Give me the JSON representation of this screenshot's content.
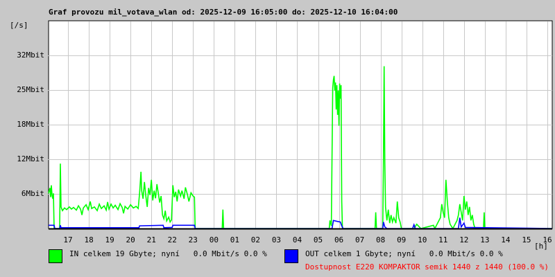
{
  "chart_data": {
    "type": "line",
    "title": "Graf provozu mil_votava_wlan od: 2025-12-09 16:05:00 do: 2025-12-10 16:04:00",
    "ylabel": "[/s]",
    "xlabel": "[h]",
    "x_units": "minutes since 16:05",
    "xlim": [
      0,
      1450
    ],
    "ylim": [
      0,
      38.4
    ],
    "grid": true,
    "y_ticks": [
      {
        "value": 6.4,
        "label": "6Mbit"
      },
      {
        "value": 12.8,
        "label": "12Mbit"
      },
      {
        "value": 19.2,
        "label": "18Mbit"
      },
      {
        "value": 25.6,
        "label": "25Mbit"
      },
      {
        "value": 32.0,
        "label": "32Mbit"
      }
    ],
    "x_ticks": [
      {
        "value": 56,
        "label": "17"
      },
      {
        "value": 116,
        "label": "18"
      },
      {
        "value": 176,
        "label": "19"
      },
      {
        "value": 236,
        "label": "20"
      },
      {
        "value": 296,
        "label": "21"
      },
      {
        "value": 356,
        "label": "22"
      },
      {
        "value": 416,
        "label": "23"
      },
      {
        "value": 476,
        "label": "00"
      },
      {
        "value": 536,
        "label": "01"
      },
      {
        "value": 596,
        "label": "02"
      },
      {
        "value": 656,
        "label": "03"
      },
      {
        "value": 716,
        "label": "04"
      },
      {
        "value": 776,
        "label": "05"
      },
      {
        "value": 836,
        "label": "06"
      },
      {
        "value": 896,
        "label": "07"
      },
      {
        "value": 956,
        "label": "08"
      },
      {
        "value": 1016,
        "label": "09"
      },
      {
        "value": 1076,
        "label": "10"
      },
      {
        "value": 1136,
        "label": "11"
      },
      {
        "value": 1196,
        "label": "12"
      },
      {
        "value": 1256,
        "label": "13"
      },
      {
        "value": 1316,
        "label": "14"
      },
      {
        "value": 1376,
        "label": "15"
      },
      {
        "value": 1436,
        "label": "16"
      }
    ],
    "series": [
      {
        "name": "IN",
        "color": "#00ff00",
        "points": [
          [
            0,
            6.5
          ],
          [
            4,
            7.5
          ],
          [
            6,
            5.8
          ],
          [
            8,
            8.0
          ],
          [
            10,
            6.2
          ],
          [
            12,
            5.5
          ],
          [
            14,
            6.5
          ],
          [
            16,
            0
          ],
          [
            32,
            0
          ],
          [
            34,
            12
          ],
          [
            36,
            4
          ],
          [
            40,
            3.3
          ],
          [
            46,
            3.8
          ],
          [
            52,
            3.5
          ],
          [
            60,
            4.0
          ],
          [
            66,
            3.6
          ],
          [
            72,
            3.9
          ],
          [
            80,
            3.4
          ],
          [
            86,
            4.2
          ],
          [
            92,
            3.6
          ],
          [
            96,
            2.5
          ],
          [
            100,
            3.8
          ],
          [
            108,
            4.4
          ],
          [
            114,
            3.5
          ],
          [
            120,
            5.0
          ],
          [
            124,
            3.7
          ],
          [
            132,
            4.0
          ],
          [
            140,
            3.3
          ],
          [
            146,
            4.5
          ],
          [
            152,
            3.7
          ],
          [
            160,
            4.2
          ],
          [
            166,
            3.4
          ],
          [
            170,
            4.9
          ],
          [
            174,
            3.6
          ],
          [
            180,
            4.5
          ],
          [
            186,
            3.8
          ],
          [
            192,
            4.3
          ],
          [
            200,
            3.5
          ],
          [
            206,
            4.6
          ],
          [
            212,
            3.9
          ],
          [
            216,
            2.8
          ],
          [
            220,
            4.1
          ],
          [
            228,
            3.6
          ],
          [
            236,
            4.4
          ],
          [
            244,
            3.8
          ],
          [
            252,
            4.1
          ],
          [
            258,
            3.7
          ],
          [
            262,
            6.5
          ],
          [
            266,
            10.5
          ],
          [
            268,
            7.0
          ],
          [
            272,
            5.5
          ],
          [
            276,
            8.6
          ],
          [
            280,
            6.0
          ],
          [
            284,
            4.0
          ],
          [
            288,
            7.5
          ],
          [
            292,
            6.2
          ],
          [
            296,
            9.0
          ],
          [
            300,
            5.2
          ],
          [
            304,
            7.0
          ],
          [
            308,
            5.6
          ],
          [
            312,
            8.2
          ],
          [
            316,
            6.5
          ],
          [
            320,
            4.8
          ],
          [
            324,
            6.0
          ],
          [
            328,
            2.5
          ],
          [
            332,
            1.8
          ],
          [
            336,
            3.3
          ],
          [
            340,
            1.4
          ],
          [
            346,
            2.1
          ],
          [
            350,
            1.2
          ],
          [
            354,
            1.6
          ],
          [
            358,
            8.0
          ],
          [
            362,
            5.8
          ],
          [
            366,
            6.8
          ],
          [
            370,
            5.0
          ],
          [
            374,
            7.2
          ],
          [
            380,
            6.0
          ],
          [
            384,
            7.0
          ],
          [
            390,
            5.5
          ],
          [
            394,
            7.6
          ],
          [
            400,
            6.2
          ],
          [
            404,
            5.0
          ],
          [
            410,
            6.6
          ],
          [
            416,
            6.0
          ],
          [
            420,
            5.8
          ],
          [
            422,
            0
          ],
          [
            500,
            0
          ],
          [
            502,
            3.5
          ],
          [
            504,
            0
          ],
          [
            808,
            0
          ],
          [
            810,
            1.5
          ],
          [
            814,
            0.5
          ],
          [
            818,
            26
          ],
          [
            820,
            27.5
          ],
          [
            822,
            28.2
          ],
          [
            824,
            25.5
          ],
          [
            826,
            27
          ],
          [
            828,
            22
          ],
          [
            830,
            26.5
          ],
          [
            832,
            21
          ],
          [
            834,
            25.5
          ],
          [
            836,
            19
          ],
          [
            838,
            26.8
          ],
          [
            840,
            24
          ],
          [
            842,
            26.5
          ],
          [
            844,
            5
          ],
          [
            846,
            0
          ],
          [
            940,
            0
          ],
          [
            942,
            3
          ],
          [
            944,
            0
          ],
          [
            962,
            0
          ],
          [
            964,
            12.5
          ],
          [
            966,
            30
          ],
          [
            968,
            12
          ],
          [
            970,
            4
          ],
          [
            974,
            1.5
          ],
          [
            978,
            3.5
          ],
          [
            982,
            1.0
          ],
          [
            986,
            2.5
          ],
          [
            990,
            1.2
          ],
          [
            994,
            2.0
          ],
          [
            1000,
            1.0
          ],
          [
            1004,
            5.0
          ],
          [
            1008,
            2.0
          ],
          [
            1012,
            1.2
          ],
          [
            1016,
            0
          ],
          [
            1052,
            0
          ],
          [
            1060,
            0.8
          ],
          [
            1072,
            0
          ],
          [
            1108,
            0.6
          ],
          [
            1112,
            0
          ],
          [
            1128,
            2.0
          ],
          [
            1132,
            4.5
          ],
          [
            1136,
            3.0
          ],
          [
            1140,
            2.0
          ],
          [
            1144,
            9.0
          ],
          [
            1148,
            5.0
          ],
          [
            1152,
            2.0
          ],
          [
            1156,
            0.8
          ],
          [
            1164,
            0
          ],
          [
            1176,
            1.5
          ],
          [
            1180,
            2.5
          ],
          [
            1184,
            4.5
          ],
          [
            1188,
            3.0
          ],
          [
            1192,
            1.5
          ],
          [
            1196,
            6.0
          ],
          [
            1200,
            3.5
          ],
          [
            1204,
            5.0
          ],
          [
            1208,
            2.5
          ],
          [
            1212,
            4.0
          ],
          [
            1216,
            1.5
          ],
          [
            1220,
            2.5
          ],
          [
            1224,
            0.8
          ],
          [
            1228,
            0
          ],
          [
            1252,
            0
          ],
          [
            1254,
            3.0
          ],
          [
            1256,
            0
          ],
          [
            1450,
            0
          ]
        ]
      },
      {
        "name": "OUT",
        "color": "#0000ff",
        "points": [
          [
            0,
            0.6
          ],
          [
            16,
            0.6
          ],
          [
            18,
            0
          ],
          [
            32,
            0
          ],
          [
            34,
            0.6
          ],
          [
            36,
            0.15
          ],
          [
            260,
            0.15
          ],
          [
            262,
            0.5
          ],
          [
            330,
            0.6
          ],
          [
            332,
            0.15
          ],
          [
            356,
            0.2
          ],
          [
            358,
            0.6
          ],
          [
            420,
            0.6
          ],
          [
            422,
            0
          ],
          [
            816,
            0
          ],
          [
            820,
            1.5
          ],
          [
            832,
            1.3
          ],
          [
            840,
            1.2
          ],
          [
            844,
            0.5
          ],
          [
            848,
            0
          ],
          [
            962,
            0
          ],
          [
            964,
            1.2
          ],
          [
            968,
            0.3
          ],
          [
            974,
            0
          ],
          [
            1048,
            0
          ],
          [
            1052,
            0.7
          ],
          [
            1056,
            0
          ],
          [
            1180,
            0
          ],
          [
            1184,
            2.0
          ],
          [
            1188,
            0.3
          ],
          [
            1196,
            1.0
          ],
          [
            1200,
            0.2
          ],
          [
            1450,
            0
          ]
        ]
      }
    ]
  },
  "legend": {
    "in_text": "IN celkem 19 Gbyte; nyní   0.0 Mbit/s 0.0 %",
    "out_text": "OUT celkem 1 Gbyte; nyní   0.0 Mbit/s 0.0 %",
    "availability": "Dostupnost E220 KOMPAKTOR semik 1440 z 1440 (100.0 %)",
    "in_color": "#00ff00",
    "out_color": "#0000ff"
  }
}
